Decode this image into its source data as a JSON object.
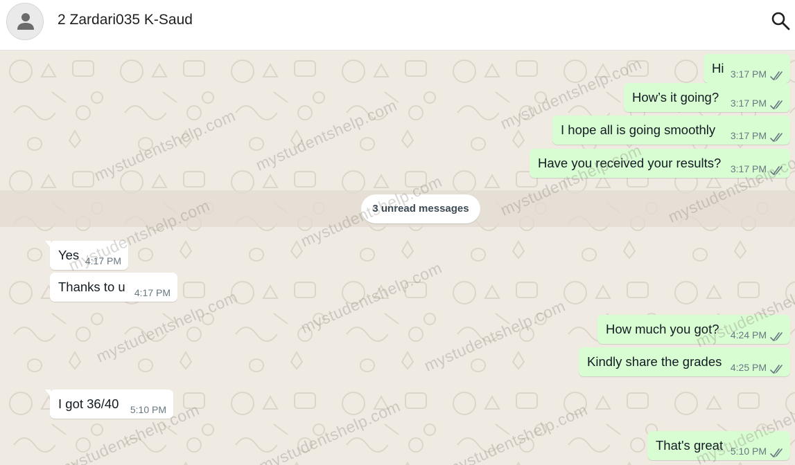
{
  "header": {
    "contact_name": "2 Zardari035 K-Saud",
    "avatar_icon": "person-icon",
    "search_icon": "search-icon"
  },
  "colors": {
    "header_bg": "#ffffff",
    "chat_bg": "#efeae2",
    "outgoing_bubble": "#d9fdd3",
    "incoming_bubble": "#ffffff"
  },
  "watermark_text": "mystudentshelp.com",
  "unread_divider": "3 unread messages",
  "messages": [
    {
      "dir": "out",
      "text": "Hi",
      "time": "3:17 PM",
      "status": "read"
    },
    {
      "dir": "out",
      "text": "How’s it going?",
      "time": "3:17 PM",
      "status": "read"
    },
    {
      "dir": "out",
      "text": "I hope all is going smoothly",
      "time": "3:17 PM",
      "status": "read"
    },
    {
      "dir": "out",
      "text": "Have you received your results?",
      "time": "3:17 PM",
      "status": "read"
    },
    {
      "dir": "in",
      "text": "Yes",
      "time": "4:17 PM"
    },
    {
      "dir": "in",
      "text": "Thanks to u",
      "time": "4:17 PM"
    },
    {
      "dir": "out",
      "text": "How much you got?",
      "time": "4:24 PM",
      "status": "read"
    },
    {
      "dir": "out",
      "text": "Kindly share the grades",
      "time": "4:25 PM",
      "status": "read"
    },
    {
      "dir": "in",
      "text": "I got 36/40",
      "time": "5:10 PM"
    },
    {
      "dir": "out",
      "text": "That's great",
      "time": "5:10 PM",
      "status": "read"
    }
  ]
}
